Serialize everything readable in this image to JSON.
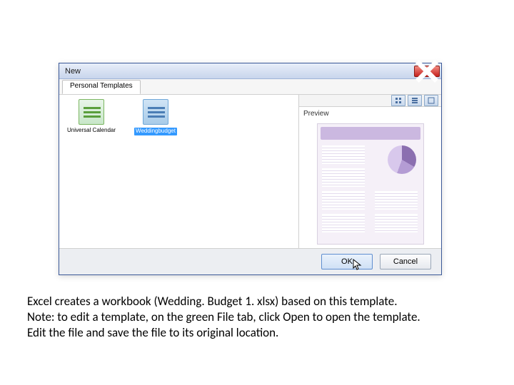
{
  "dialog": {
    "title": "New",
    "tab_label": "Personal Templates",
    "templates": [
      {
        "label": "Universal Calendar",
        "selected": false
      },
      {
        "label": "Weddingbudget",
        "selected": true
      }
    ],
    "preview_label": "Preview",
    "ok_label": "OK",
    "cancel_label": "Cancel"
  },
  "caption": {
    "line1": "Excel creates a workbook (Wedding. Budget 1. xlsx) based on this template.",
    "line2": "Note: to edit a template, on the green File tab, click Open to open the template.",
    "line3": "Edit the file and save the file to its original location."
  }
}
